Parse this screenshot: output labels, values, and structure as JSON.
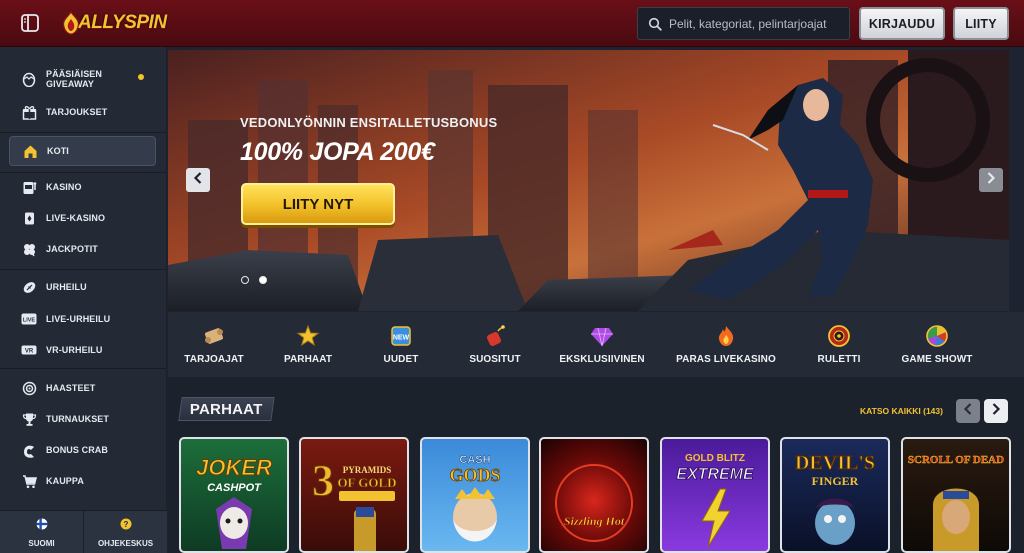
{
  "header": {
    "brand": "ALLYSPIN",
    "search_placeholder": "Pelit, kategoriat, pelintarjoajat",
    "login_label": "KIRJAUDU",
    "join_label": "LIITY"
  },
  "sidebar": {
    "items": [
      {
        "label": "PÄÄSIÄISEN GIVEAWAY",
        "icon": "egg-icon"
      },
      {
        "label": "TARJOUKSET",
        "icon": "gift-icon"
      },
      {
        "label": "KOTI",
        "icon": "home-icon"
      },
      {
        "label": "KASINO",
        "icon": "slot-machine-icon"
      },
      {
        "label": "LIVE-KASINO",
        "icon": "card-icon"
      },
      {
        "label": "JACKPOTIT",
        "icon": "clover-icon"
      },
      {
        "label": "URHEILU",
        "icon": "football-icon"
      },
      {
        "label": "LIVE-URHEILU",
        "icon": "live-icon"
      },
      {
        "label": "VR-URHEILU",
        "icon": "vr-icon"
      },
      {
        "label": "HAASTEET",
        "icon": "target-icon"
      },
      {
        "label": "TURNAUKSET",
        "icon": "trophy-icon"
      },
      {
        "label": "BONUS CRAB",
        "icon": "claw-icon"
      },
      {
        "label": "KAUPPA",
        "icon": "cart-icon"
      }
    ],
    "footer": {
      "language_label": "SUOMI",
      "help_label": "OHJEKESKUS"
    }
  },
  "hero": {
    "subtitle": "VEDONLYÖNNIN ENSITALLETUSBONUS",
    "title": "100% JOPA 200€",
    "cta_label": "LIITY NYT"
  },
  "categories": [
    {
      "label": "TARJOAJAT",
      "icon": "scroll-icon"
    },
    {
      "label": "PARHAAT",
      "icon": "star-icon"
    },
    {
      "label": "UUDET",
      "icon": "new-badge-icon"
    },
    {
      "label": "SUOSITUT",
      "icon": "dynamite-icon"
    },
    {
      "label": "EKSKLUSIIVINEN",
      "icon": "diamond-icon"
    },
    {
      "label": "PARAS LIVEKASINO",
      "icon": "flame-icon"
    },
    {
      "label": "RULETTI",
      "icon": "roulette-icon"
    },
    {
      "label": "GAME SHOWT",
      "icon": "wheel-icon"
    }
  ],
  "games_section": {
    "title": "PARHAAT",
    "see_all_label": "KATSO KAIKKI (143)",
    "games": [
      {
        "name": "Joker Cashpot"
      },
      {
        "name": "3 Pyramids of Gold Hold & Win"
      },
      {
        "name": "Cash of Gods"
      },
      {
        "name": "Sizzling Hot Deluxe"
      },
      {
        "name": "Gold Blitz Extreme"
      },
      {
        "name": "Devil's Finger"
      },
      {
        "name": "Scroll of Dead"
      }
    ]
  },
  "colors": {
    "header_bg": "#5a0c13",
    "accent_gold": "#f2c230",
    "sidebar_bg": "#232935"
  }
}
